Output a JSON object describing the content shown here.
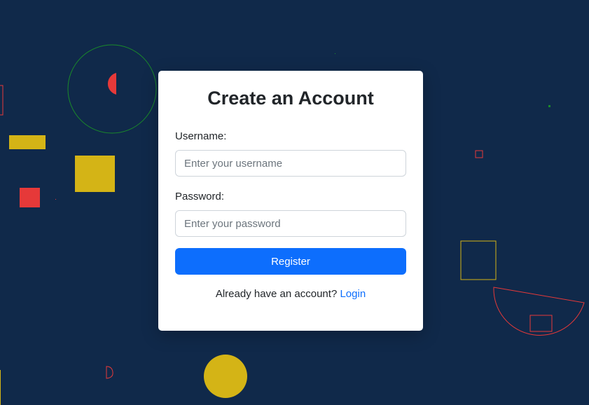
{
  "page": {
    "background_color": "#10294a"
  },
  "form": {
    "title": "Create an Account",
    "username_label": "Username:",
    "username_placeholder": "Enter your username",
    "username_value": "",
    "password_label": "Password:",
    "password_placeholder": "Enter your password",
    "password_value": "",
    "register_label": "Register",
    "login_prompt": "Already have an account?",
    "login_link": "Login"
  },
  "colors": {
    "primary": "#0d6efd",
    "decor_red": "#e63939",
    "decor_yellow": "#d4b416",
    "decor_green": "#1a8a2a"
  }
}
